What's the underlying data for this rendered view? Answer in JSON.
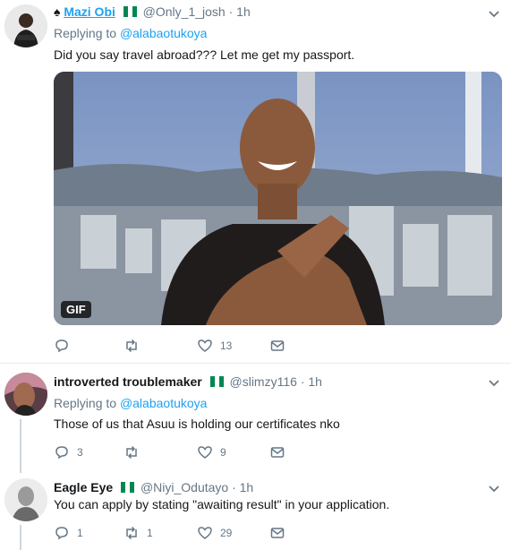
{
  "tweets": [
    {
      "name": "Mazi Obi",
      "handle": "@Only_1_josh",
      "time": "· 1h",
      "replying_label": "Replying to",
      "replying_to": "@alabaotukoya",
      "text": "Did you say travel abroad??? Let me get my passport.",
      "media_badge": "GIF",
      "likes": "13"
    },
    {
      "name": "introverted troublemaker",
      "handle": "@slimzy116",
      "time": "· 1h",
      "replying_label": "Replying to",
      "replying_to": "@alabaotukoya",
      "text": "Those of us that Asuu is holding our certificates nko",
      "replies": "3",
      "likes": "9"
    },
    {
      "name": "Eagle Eye",
      "handle": "@Niyi_Odutayo",
      "time": "· 1h",
      "text": "You can apply by stating \"awaiting result\" in your application.",
      "replies": "1",
      "retweets": "1",
      "likes": "29"
    }
  ],
  "colors": {
    "accent": "#1da1f2",
    "muted": "#657786",
    "flag_green": "#008751",
    "divider": "#e6ecf0"
  }
}
